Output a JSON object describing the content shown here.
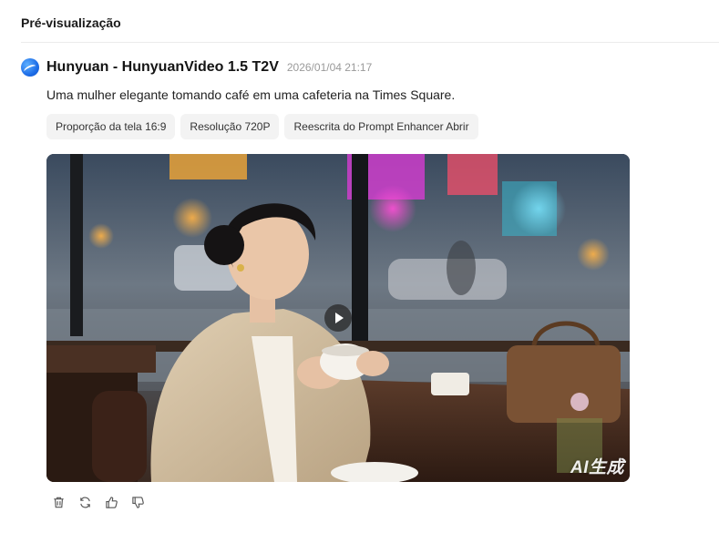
{
  "panel": {
    "title": "Pré-visualização"
  },
  "message": {
    "model_name": "Hunyuan - HunyuanVideo 1.5 T2V",
    "timestamp": "2026/01/04 21:17",
    "prompt": "Uma mulher elegante tomando café em uma cafeteria na Times Square.",
    "tags": [
      "Proporção da tela 16:9",
      "Resolução 720P",
      "Reescrita do Prompt Enhancer Abrir"
    ],
    "video": {
      "watermark": "AI生成",
      "play_icon": "play-icon"
    }
  },
  "actions": {
    "icons": [
      "trash-icon",
      "regenerate-icon",
      "thumbs-up-icon",
      "thumbs-down-icon"
    ]
  },
  "colors": {
    "accent": "#1e6ee8",
    "tag_background": "#f3f3f3",
    "muted_text": "#9a9a9a"
  }
}
